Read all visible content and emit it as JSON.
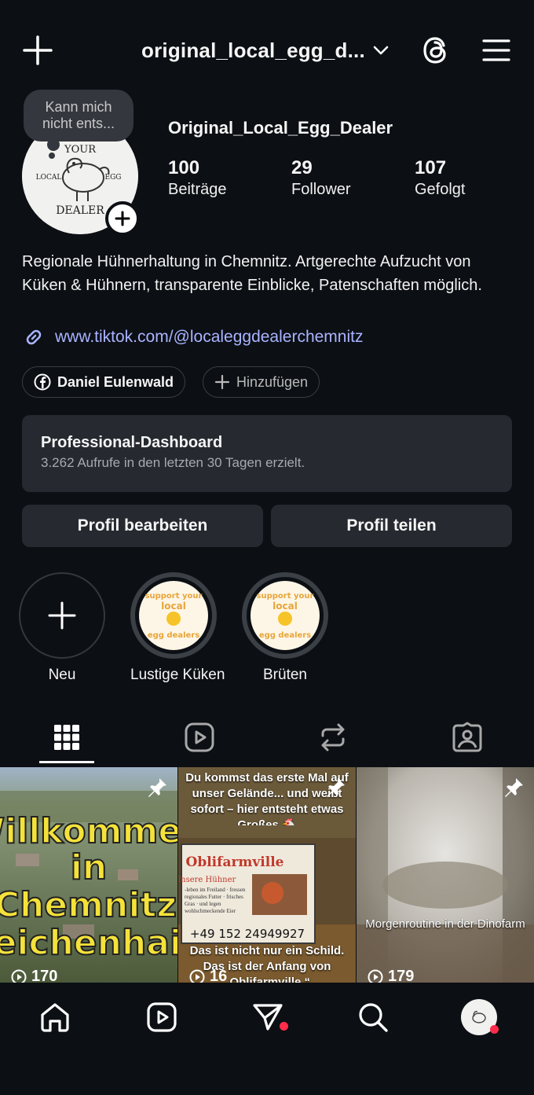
{
  "header": {
    "title": "original_local_egg_d...",
    "icons": [
      "plus-icon",
      "chevron-down-icon",
      "threads-icon",
      "menu-icon"
    ]
  },
  "profile": {
    "note": "Kann mich nicht ents...",
    "name": "Original_Local_Egg_Dealer",
    "avatar_text": {
      "top": "YOUR",
      "left": "LOCAL",
      "right": "EGG",
      "bottom": "DEALER"
    },
    "stats": [
      {
        "value": "100",
        "label": "Beiträge"
      },
      {
        "value": "29",
        "label": "Follower"
      },
      {
        "value": "107",
        "label": "Gefolgt"
      }
    ],
    "bio": "Regionale Hühnerhaltung in Chemnitz. Artgerechte Aufzucht von Küken & Hühnern, transparente Einblicke, Patenschaften möglich.",
    "link": "www.tiktok.com/@localeggdealerchemnitz",
    "chips": {
      "facebook": "Daniel Eulenwald",
      "add": "Hinzufügen"
    }
  },
  "dashboard": {
    "title": "Professional-Dashboard",
    "subtitle": "3.262 Aufrufe in den letzten 30 Tagen erzielt."
  },
  "buttons": {
    "edit": "Profil bearbeiten",
    "share": "Profil teilen"
  },
  "highlights": [
    {
      "label": "Neu"
    },
    {
      "label": "Lustige Küken"
    },
    {
      "label": "Brüten"
    }
  ],
  "highlight_sticker": {
    "line1": "support your",
    "line2": "local",
    "line3": "egg dealers"
  },
  "tabs": [
    "grid-icon",
    "reels-icon",
    "reposts-icon",
    "tagged-icon"
  ],
  "posts": [
    {
      "overlay_lines": [
        "Willkommen",
        "in",
        "Chemnitz-",
        "Reichenhain"
      ],
      "views": "170"
    },
    {
      "caption_top": "Du kommst das erste Mal auf unser Gelände... und weißt sofort – hier entsteht etwas Großes 🐔",
      "sign_title": "Oblifarmville",
      "sign_sub": "Unsere Hühner",
      "sign_notes": "-leben im Freiland · fressen regionales Futter · frisches Gras · und legen wohlschmeckende Eier",
      "phone": "+49 152 24949927",
      "caption_bottom": "Das ist nicht nur ein Schild. Das ist der Anfang von „Oblifarmville.“",
      "views": "16"
    },
    {
      "caption": "Morgenroutine in der Dinofarm",
      "views": "179"
    }
  ],
  "colors": {
    "background": "#0c0f14",
    "card": "#262a30",
    "link": "#a9b4ff",
    "notification": "#ff2d4a"
  }
}
